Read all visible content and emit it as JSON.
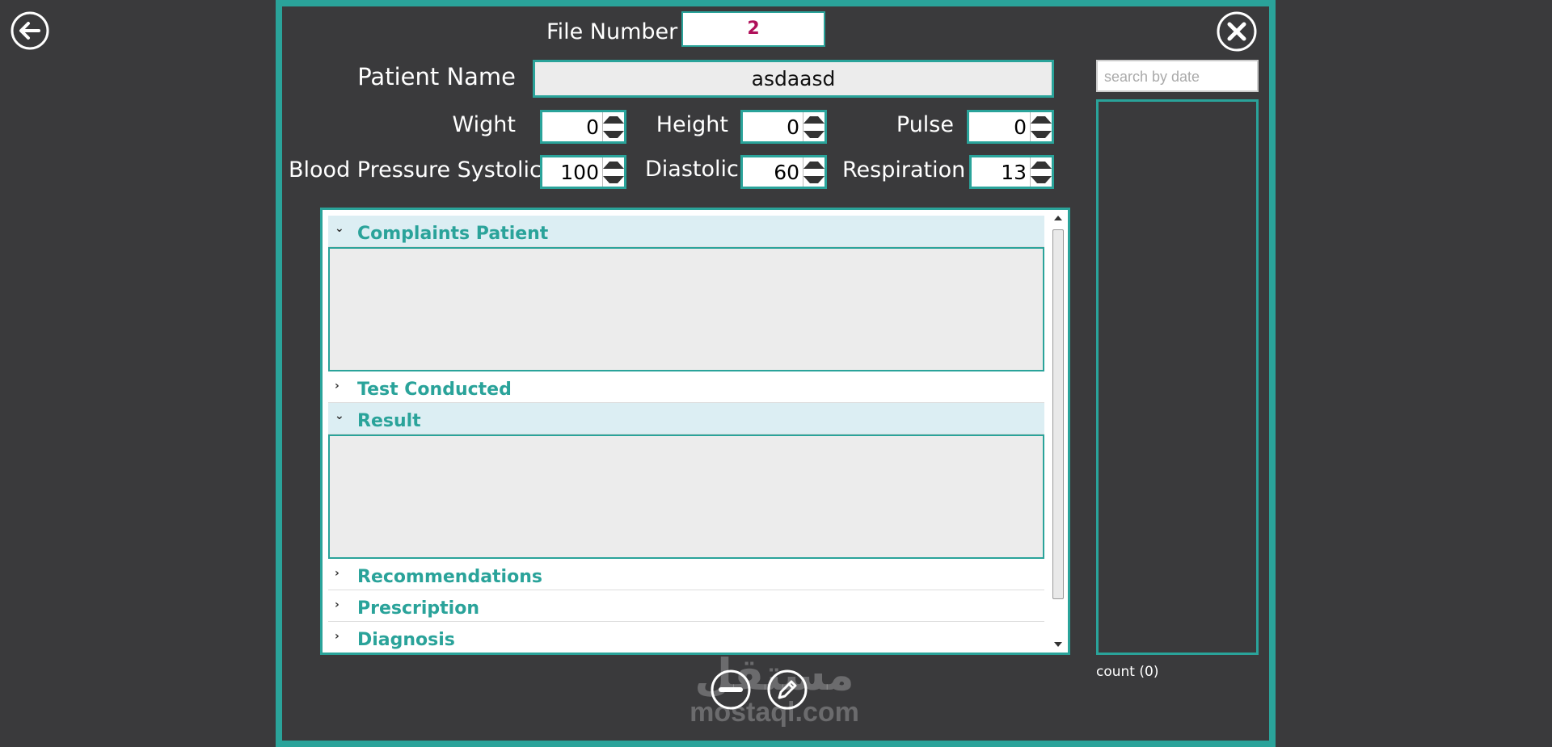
{
  "header": {
    "file_number_label": "File Number",
    "file_number_value": "2",
    "patient_name_label": "Patient Name",
    "patient_name_value": "asdaasd"
  },
  "vitals": {
    "weight_label": "Wight",
    "weight_value": "0",
    "height_label": "Height",
    "height_value": "0",
    "pulse_label": "Pulse",
    "pulse_value": "0",
    "systolic_label": "Blood Pressure Systolic",
    "systolic_value": "100",
    "diastolic_label": "Diastolic",
    "diastolic_value": "60",
    "respiration_label": "Respiration",
    "respiration_value": "13"
  },
  "sections": [
    {
      "title": "Complaints Patient",
      "expanded": true
    },
    {
      "title": "Test Conducted",
      "expanded": false
    },
    {
      "title": "Result",
      "expanded": true
    },
    {
      "title": "Recommendations",
      "expanded": false
    },
    {
      "title": "Prescription",
      "expanded": false
    },
    {
      "title": "Diagnosis",
      "expanded": false
    }
  ],
  "sidebar": {
    "search_placeholder": "search by date",
    "count_label": "count (0)"
  },
  "watermark": {
    "arabic": "مستقل",
    "latin": "mostaql.com"
  },
  "icons": {
    "back": "arrow-left-circle-icon",
    "close": "close-circle-icon",
    "remove": "minus-circle-icon",
    "edit": "pencil-circle-icon"
  },
  "colors": {
    "accent": "#2aa39a",
    "background": "#3a3a3c",
    "file_number_text": "#b0105a",
    "section_open_bg": "#dceef3"
  }
}
